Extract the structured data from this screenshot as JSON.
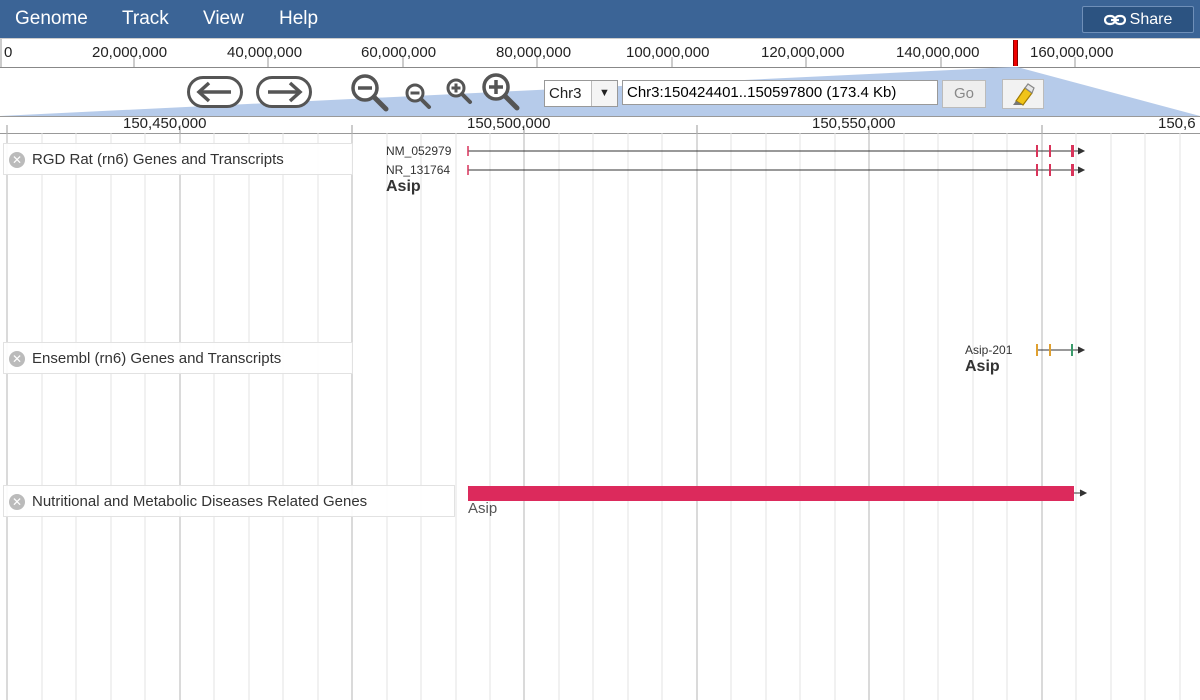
{
  "menu": {
    "genome": "Genome",
    "track": "Track",
    "view": "View",
    "help": "Help",
    "share": "Share"
  },
  "overview_ticks": [
    "0",
    "20,000,000",
    "40,000,000",
    "60,000,000",
    "80,000,000",
    "100,000,000",
    "120,000,000",
    "140,000,000",
    "160,000,000"
  ],
  "navigation": {
    "chromosome": "Chr3",
    "location": "Chr3:150424401..150597800 (173.4 Kb)",
    "go_label": "Go"
  },
  "detail_ticks": [
    "150,450,000",
    "150,500,000",
    "150,550,000",
    "150,6"
  ],
  "tracks": [
    {
      "label": "RGD Rat (rn6) Genes and Transcripts",
      "transcripts": [
        "NM_052979",
        "NR_131764"
      ],
      "gene": "Asip"
    },
    {
      "label": "Ensembl (rn6) Genes and Transcripts",
      "transcripts": [
        "Asip-201"
      ],
      "gene": "Asip"
    },
    {
      "label": "Nutritional and Metabolic Diseases Related Genes",
      "feature": "Asip"
    }
  ],
  "colors": {
    "menubar": "#3b6496",
    "exon_red": "#d9335a",
    "ensembl_orange": "#e0a030",
    "feature_bar": "#dc2a5c",
    "zoom_cone": "#a9c2e6"
  }
}
